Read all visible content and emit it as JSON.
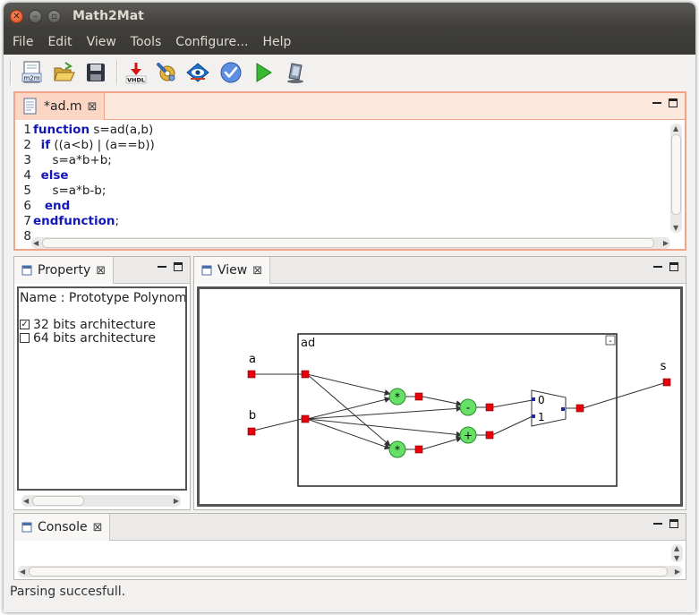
{
  "window": {
    "title": "Math2Mat"
  },
  "menu": [
    "File",
    "Edit",
    "View",
    "Tools",
    "Configure...",
    "Help"
  ],
  "toolbar": {
    "m2m_label": "m2m",
    "vhdl_label": "VHDL",
    "icons": [
      "new-m2m-icon",
      "open-folder-icon",
      "save-icon",
      "generate-vhdl-icon",
      "settings-icon",
      "view-icon",
      "check-icon",
      "run-icon",
      "device-icon"
    ]
  },
  "editor": {
    "tab_label": "*ad.m",
    "lines": [
      {
        "num": "1",
        "parts": [
          {
            "t": "function",
            "kw": true
          },
          {
            "t": " s=ad(a,b)",
            "kw": false
          }
        ]
      },
      {
        "num": "2",
        "parts": [
          {
            "t": "  ",
            "kw": false
          },
          {
            "t": "if",
            "kw": true
          },
          {
            "t": " ((a<b) | (a==b))",
            "kw": false
          }
        ]
      },
      {
        "num": "3",
        "parts": [
          {
            "t": "     s=a*b+b;",
            "kw": false
          }
        ]
      },
      {
        "num": "4",
        "parts": [
          {
            "t": "  ",
            "kw": false
          },
          {
            "t": "else",
            "kw": true
          }
        ]
      },
      {
        "num": "5",
        "parts": [
          {
            "t": "     s=a*b-b;",
            "kw": false
          }
        ]
      },
      {
        "num": "6",
        "parts": [
          {
            "t": "   ",
            "kw": false
          },
          {
            "t": "end",
            "kw": true
          }
        ]
      },
      {
        "num": "7",
        "parts": [
          {
            "t": "endfunction",
            "kw": true
          },
          {
            "t": ";",
            "kw": false
          }
        ]
      },
      {
        "num": "8",
        "parts": []
      }
    ]
  },
  "property": {
    "tab_label": "Property",
    "name_label": "Name : Prototype Polynome",
    "options": [
      {
        "label": "32 bits architecture",
        "checked": true
      },
      {
        "label": "64 bits architecture",
        "checked": false
      }
    ]
  },
  "view": {
    "tab_label": "View",
    "block_name": "ad",
    "collapse_label": "-",
    "inputs": [
      "a",
      "b"
    ],
    "output": "s",
    "ops": [
      "*",
      "*",
      "-",
      "+"
    ],
    "mux_labels": [
      "0",
      "1"
    ]
  },
  "console": {
    "tab_label": "Console"
  },
  "status": "Parsing succesfull.",
  "colors": {
    "accent": "#f0a488",
    "keyword": "#1417b8",
    "port": "#e8000b",
    "op": "#66e066"
  }
}
